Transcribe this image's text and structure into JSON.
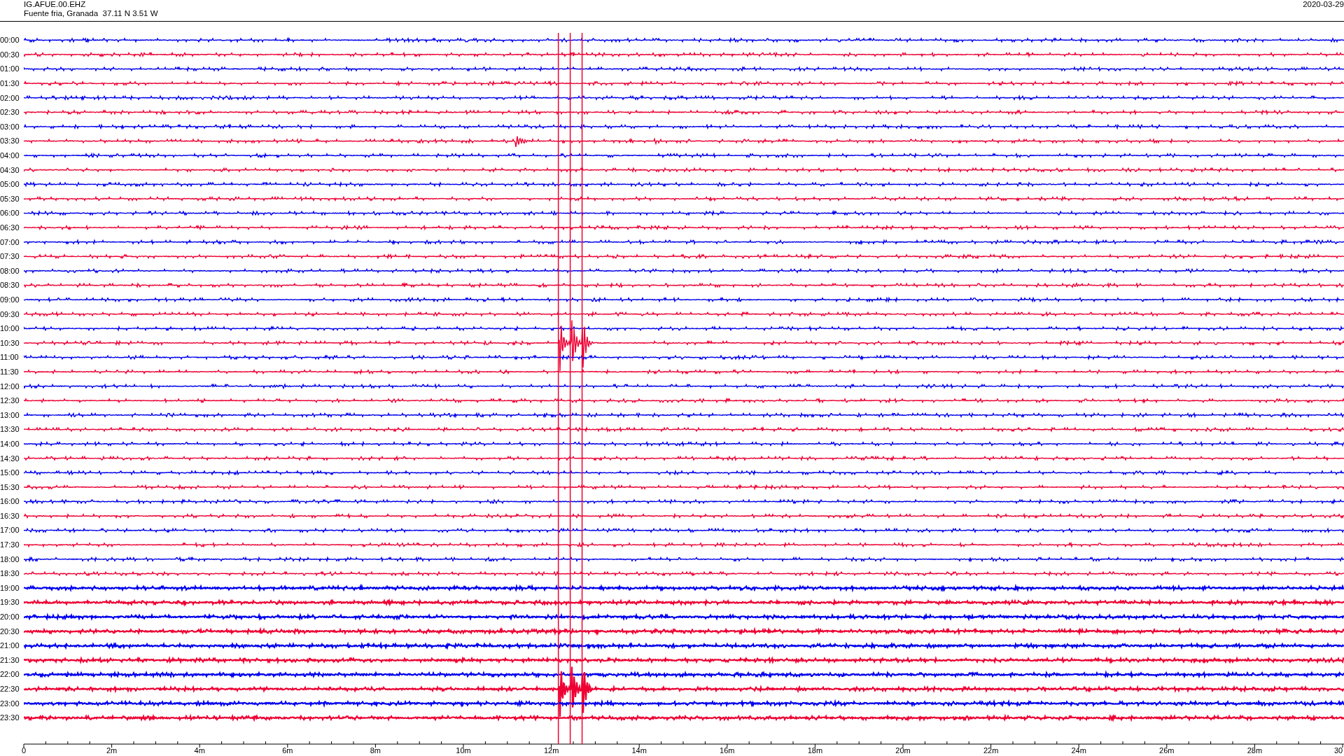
{
  "header": {
    "station": "IG.AFUE.00.EHZ",
    "location": "Fuente fria, Granada  37.11 N 3.51 W",
    "date": "2020-03-29"
  },
  "rows": [
    {
      "label": "00:00",
      "color": "#0000ee"
    },
    {
      "label": "00:30",
      "color": "#ee0033"
    },
    {
      "label": "01:00",
      "color": "#0000ee"
    },
    {
      "label": "01:30",
      "color": "#ee0033"
    },
    {
      "label": "02:00",
      "color": "#0000ee"
    },
    {
      "label": "02:30",
      "color": "#ee0033"
    },
    {
      "label": "03:00",
      "color": "#0000ee"
    },
    {
      "label": "03:30",
      "color": "#ee0033"
    },
    {
      "label": "04:00",
      "color": "#0000ee"
    },
    {
      "label": "04:30",
      "color": "#ee0033"
    },
    {
      "label": "05:00",
      "color": "#0000ee"
    },
    {
      "label": "05:30",
      "color": "#ee0033"
    },
    {
      "label": "06:00",
      "color": "#0000ee"
    },
    {
      "label": "06:30",
      "color": "#ee0033"
    },
    {
      "label": "07:00",
      "color": "#0000ee"
    },
    {
      "label": "07:30",
      "color": "#ee0033"
    },
    {
      "label": "08:00",
      "color": "#0000ee"
    },
    {
      "label": "08:30",
      "color": "#ee0033"
    },
    {
      "label": "09:00",
      "color": "#0000ee"
    },
    {
      "label": "09:30",
      "color": "#ee0033"
    },
    {
      "label": "10:00",
      "color": "#0000ee"
    },
    {
      "label": "10:30",
      "color": "#ee0033"
    },
    {
      "label": "11:00",
      "color": "#0000ee"
    },
    {
      "label": "11:30",
      "color": "#ee0033"
    },
    {
      "label": "12:00",
      "color": "#0000ee"
    },
    {
      "label": "12:30",
      "color": "#ee0033"
    },
    {
      "label": "13:00",
      "color": "#0000ee"
    },
    {
      "label": "13:30",
      "color": "#ee0033"
    },
    {
      "label": "14:00",
      "color": "#0000ee"
    },
    {
      "label": "14:30",
      "color": "#ee0033"
    },
    {
      "label": "15:00",
      "color": "#0000ee"
    },
    {
      "label": "15:30",
      "color": "#ee0033"
    },
    {
      "label": "16:00",
      "color": "#0000ee"
    },
    {
      "label": "16:30",
      "color": "#ee0033"
    },
    {
      "label": "17:00",
      "color": "#0000ee"
    },
    {
      "label": "17:30",
      "color": "#ee0033"
    },
    {
      "label": "18:00",
      "color": "#0000ee"
    },
    {
      "label": "18:30",
      "color": "#ee0033"
    },
    {
      "label": "19:00",
      "color": "#0000ee"
    },
    {
      "label": "19:30",
      "color": "#ee0033"
    },
    {
      "label": "20:00",
      "color": "#0000ee"
    },
    {
      "label": "20:30",
      "color": "#ee0033"
    },
    {
      "label": "21:00",
      "color": "#0000ee"
    },
    {
      "label": "21:30",
      "color": "#ee0033"
    },
    {
      "label": "22:00",
      "color": "#0000ee"
    },
    {
      "label": "22:30",
      "color": "#ee0033"
    },
    {
      "label": "23:00",
      "color": "#0000ee"
    },
    {
      "label": "23:30",
      "color": "#ee0033"
    }
  ],
  "axis": {
    "ticks": [
      "0",
      "2m",
      "4m",
      "6m",
      "8m",
      "10m",
      "12m",
      "14m",
      "16m",
      "18m",
      "20m",
      "22m",
      "24m",
      "26m",
      "28m",
      "30"
    ]
  }
}
